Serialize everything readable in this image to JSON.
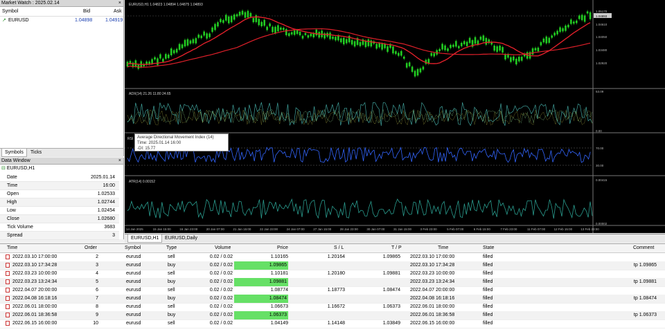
{
  "market_watch": {
    "title": "Market Watch : 2025.02.14",
    "close": "×",
    "col_symbol": "Symbol",
    "col_bid": "Bid",
    "col_ask": "Ask",
    "symbol": "EURUSD",
    "bid": "1.04898",
    "ask": "1.04919",
    "tabs": [
      "Symbols",
      "Ticks"
    ]
  },
  "data_window": {
    "title": "Data Window",
    "close": "×",
    "symbol": "EURUSD,H1",
    "rows": [
      {
        "k": "Date",
        "v": "2025.01.14"
      },
      {
        "k": "Time",
        "v": "16:00"
      },
      {
        "k": "Open",
        "v": "1.02533"
      },
      {
        "k": "High",
        "v": "1.02744"
      },
      {
        "k": "Low",
        "v": "1.02454"
      },
      {
        "k": "Close",
        "v": "1.02680"
      },
      {
        "k": "Tick Volume",
        "v": "3683"
      },
      {
        "k": "Spread",
        "v": "3"
      }
    ]
  },
  "chart": {
    "main_label": "EURUSD,H1  1.04823 1.04894 1.04875 1.04893",
    "adx_label": "ADX(14) 21.26  11.80  24.65",
    "rsi_label": "RSI",
    "atr_label": "ATR(14) 0.00152",
    "price_ticks": [
      "1.05170",
      "1.04610",
      "1.04050",
      "1.03480",
      "1.02920"
    ],
    "current_price": "1.04893",
    "adx_ticks": [
      "53.09",
      "0.00"
    ],
    "rsi_ticks": [
      "70.00",
      "30.00"
    ],
    "atr_ticks": [
      "0.00415",
      "0.00002"
    ],
    "time_ticks": [
      "14 Jan 2025",
      "15 Jan 15:00",
      "16 Jan 23:00",
      "20 Jan 07:00",
      "21 Jan 15:00",
      "22 Jan 23:00",
      "24 Jan 07:00",
      "27 Jan 15:00",
      "28 Jan 23:00",
      "30 Jan 07:00",
      "31 Jan 15:00",
      "3 Feb 23:00",
      "5 Feb 07:00",
      "6 Feb 15:00",
      "7 Feb 23:00",
      "11 Feb 07:00",
      "12 Feb 15:00",
      "13 Feb 23:00"
    ],
    "tabs": [
      "EURUSD,H1",
      "EURUSD,Daily"
    ],
    "colors": {
      "candles": "#22cc22",
      "ma": "#e0202a",
      "rsi": "#3366ff",
      "atr": "#2a9d8f",
      "adx": "#3fa09a"
    }
  },
  "tooltip": {
    "title": "Average Directional Movement Index (14)",
    "time": "Time: 2025.01.14 16:00",
    "value": "-DI: 15.77"
  },
  "orders": {
    "columns": [
      "Time",
      "Order",
      "Symbol",
      "Type",
      "Volume",
      "Price",
      "S / L",
      "T / P",
      "Time",
      "State",
      "Comment"
    ],
    "rows": [
      {
        "time": "2022.03.10 17:00:00",
        "order": "2",
        "symbol": "eurusd",
        "type": "sell",
        "volume": "0.02 / 0.02",
        "price": "1.10165",
        "sl": "1.20164",
        "tp": "1.09865",
        "time2": "2022.03.10 17:00:00",
        "state": "filled",
        "comment": "",
        "hl": false
      },
      {
        "time": "2022.03.10 17:34:28",
        "order": "3",
        "symbol": "eurusd",
        "type": "buy",
        "volume": "0.02 / 0.02",
        "price": "1.09865",
        "sl": "",
        "tp": "",
        "time2": "2022.03.10 17:34:28",
        "state": "filled",
        "comment": "tp 1.09865",
        "hl": true
      },
      {
        "time": "2022.03.23 10:00:00",
        "order": "4",
        "symbol": "eurusd",
        "type": "sell",
        "volume": "0.02 / 0.02",
        "price": "1.10181",
        "sl": "1.20180",
        "tp": "1.09881",
        "time2": "2022.03.23 10:00:00",
        "state": "filled",
        "comment": "",
        "hl": false
      },
      {
        "time": "2022.03.23 13:24:34",
        "order": "5",
        "symbol": "eurusd",
        "type": "buy",
        "volume": "0.02 / 0.02",
        "price": "1.09881",
        "sl": "",
        "tp": "",
        "time2": "2022.03.23 13:24:34",
        "state": "filled",
        "comment": "tp 1.09881",
        "hl": true
      },
      {
        "time": "2022.04.07 20:00:00",
        "order": "6",
        "symbol": "eurusd",
        "type": "sell",
        "volume": "0.02 / 0.02",
        "price": "1.08774",
        "sl": "1.18773",
        "tp": "1.08474",
        "time2": "2022.04.07 20:00:00",
        "state": "filled",
        "comment": "",
        "hl": false
      },
      {
        "time": "2022.04.08 16:18:16",
        "order": "7",
        "symbol": "eurusd",
        "type": "buy",
        "volume": "0.02 / 0.02",
        "price": "1.08474",
        "sl": "",
        "tp": "",
        "time2": "2022.04.08 16:18:16",
        "state": "filled",
        "comment": "tp 1.08474",
        "hl": true
      },
      {
        "time": "2022.06.01 18:00:00",
        "order": "8",
        "symbol": "eurusd",
        "type": "sell",
        "volume": "0.02 / 0.02",
        "price": "1.06673",
        "sl": "1.16672",
        "tp": "1.06373",
        "time2": "2022.06.01 18:00:00",
        "state": "filled",
        "comment": "",
        "hl": false
      },
      {
        "time": "2022.06.01 18:36:58",
        "order": "9",
        "symbol": "eurusd",
        "type": "buy",
        "volume": "0.02 / 0.02",
        "price": "1.06373",
        "sl": "",
        "tp": "",
        "time2": "2022.06.01 18:36:58",
        "state": "filled",
        "comment": "tp 1.06373",
        "hl": true
      },
      {
        "time": "2022.06.15 16:00:00",
        "order": "10",
        "symbol": "eurusd",
        "type": "sell",
        "volume": "0.02 / 0.02",
        "price": "1.04149",
        "sl": "1.14148",
        "tp": "1.03849",
        "time2": "2022.06.15 16:00:00",
        "state": "filled",
        "comment": "",
        "hl": false
      }
    ]
  }
}
